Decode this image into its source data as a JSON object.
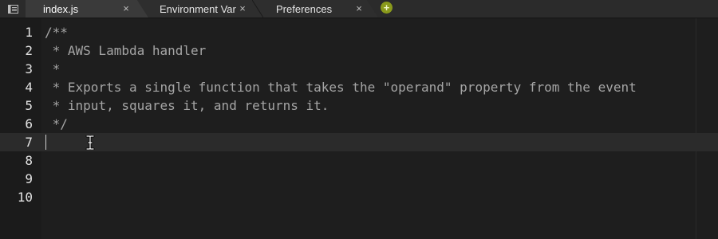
{
  "tabs": [
    {
      "label": "index.js",
      "active": true
    },
    {
      "label": "Environment Var",
      "active": false
    },
    {
      "label": "Preferences",
      "active": false
    }
  ],
  "tab_close_glyph": "×",
  "add_tab_glyph": "+",
  "colors": {
    "add_tab": "#8a9a1c",
    "comment_text": "#a5a5a5",
    "line_numbers": "#e2e2e2",
    "active_line": "#2b2b2b"
  },
  "editor": {
    "active_line": 7,
    "lines": [
      {
        "number": "1",
        "text": "/**"
      },
      {
        "number": "2",
        "text": " * AWS Lambda handler"
      },
      {
        "number": "3",
        "text": " *"
      },
      {
        "number": "4",
        "text": " * Exports a single function that takes the \"operand\" property from the event"
      },
      {
        "number": "5",
        "text": " * input, squares it, and returns it."
      },
      {
        "number": "6",
        "text": " */"
      },
      {
        "number": "7",
        "text": ""
      },
      {
        "number": "8",
        "text": ""
      },
      {
        "number": "9",
        "text": ""
      },
      {
        "number": "10",
        "text": ""
      }
    ]
  }
}
